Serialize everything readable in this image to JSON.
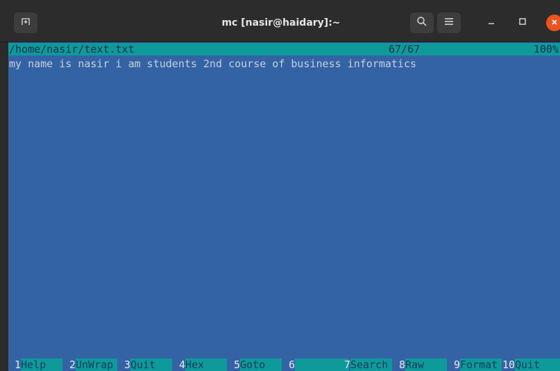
{
  "window": {
    "title": "mc [nasir@haidary]:~"
  },
  "icons": {
    "new_tab": "new-tab-icon",
    "search": "search-icon",
    "menu": "hamburger-menu-icon",
    "minimize": "minimize-icon",
    "maximize": "maximize-icon",
    "close": "close-icon"
  },
  "colors": {
    "terminal_bg": "#3463a5",
    "status_bg": "#0e9a9a",
    "close_button": "#e95420"
  },
  "viewer": {
    "file_path": "/home/nasir/text.txt",
    "position": "67/67",
    "percent": "100%",
    "content": "my name is nasir i am students 2nd course of business informatics"
  },
  "function_keys": [
    {
      "num": "1",
      "label": "Help"
    },
    {
      "num": "2",
      "label": "UnWrap"
    },
    {
      "num": "3",
      "label": "Quit"
    },
    {
      "num": "4",
      "label": "Hex"
    },
    {
      "num": "5",
      "label": "Goto"
    },
    {
      "num": "6",
      "label": ""
    },
    {
      "num": "7",
      "label": "Search"
    },
    {
      "num": "8",
      "label": "Raw"
    },
    {
      "num": "9",
      "label": "Format"
    },
    {
      "num": "10",
      "label": "Quit"
    }
  ]
}
